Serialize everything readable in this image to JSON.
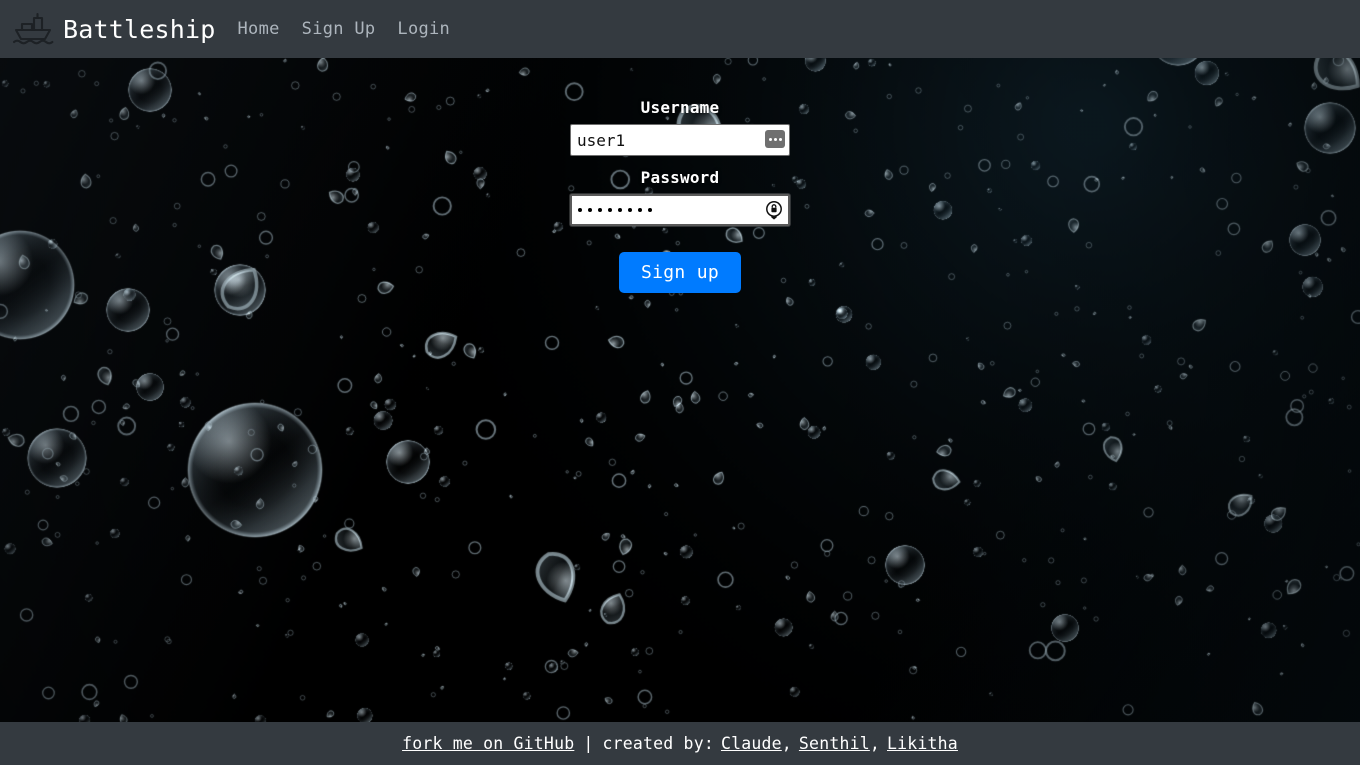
{
  "navbar": {
    "brand_icon": "ship-icon",
    "brand": "Battleship",
    "links": [
      {
        "label": "Home",
        "name": "nav-link-home"
      },
      {
        "label": "Sign Up",
        "name": "nav-link-signup"
      },
      {
        "label": "Login",
        "name": "nav-link-login"
      }
    ]
  },
  "form": {
    "username_label": "Username",
    "username_value": "user1",
    "username_placeholder": "",
    "username_autofill_icon": "autofill-dots-icon",
    "password_label": "Password",
    "password_value": "••••••••",
    "password_dot_count": 8,
    "password_placeholder": "",
    "password_manager_icon": "key-lock-icon",
    "submit_label": "Sign up"
  },
  "footer": {
    "github_link": "fork me on GitHub",
    "separator": "|",
    "credit_prefix": "created by:",
    "authors": [
      {
        "name": "Claude",
        "trailing": ","
      },
      {
        "name": "Senthil",
        "trailing": ","
      },
      {
        "name": "Likitha",
        "trailing": ""
      }
    ]
  },
  "colors": {
    "navbar_bg": "#343a40",
    "footer_bg": "#343a40",
    "accent_button": "#007bff",
    "nav_link": "#adb5bd",
    "text_white": "#ffffff",
    "background_dark": "#000000"
  }
}
